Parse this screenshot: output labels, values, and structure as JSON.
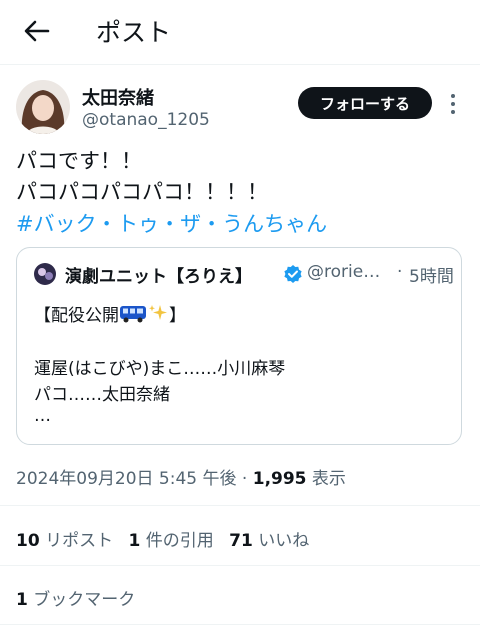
{
  "header": {
    "title": "ポスト",
    "back_icon": "arrow-left-icon"
  },
  "author": {
    "name": "太田奈緒",
    "handle": "@otanao_1205"
  },
  "follow_label": "フォローする",
  "body": {
    "line1": "パコです！！",
    "line2": "パコパコパコパコ！！！！",
    "hashtag": "#バック・トゥ・ザ・うんちゃん"
  },
  "quote": {
    "name": "演劇ユニット【ろりえ】",
    "handle": "@rorie…",
    "dot": "·",
    "time": "5時間",
    "line1_prefix": "【配役公開",
    "line1_suffix": "】",
    "line2": "運屋(はこびや)まこ……小川麻琴",
    "line3": "パコ……太田奈緒",
    "line4": "…"
  },
  "meta": {
    "datetime": "2024年09月20日 5:45 午後",
    "separator": "·",
    "views_count": "1,995",
    "views_label": "表示"
  },
  "stats": {
    "reposts_count": "10",
    "reposts_label": "リポスト",
    "quotes_count": "1",
    "quotes_label": "件の引用",
    "likes_count": "71",
    "likes_label": "いいね"
  },
  "bookmarks": {
    "count": "1",
    "label": "ブックマーク"
  },
  "colors": {
    "accent": "#1d9bf0",
    "text": "#0f1419",
    "muted": "#536471",
    "border": "#cfd9de"
  }
}
